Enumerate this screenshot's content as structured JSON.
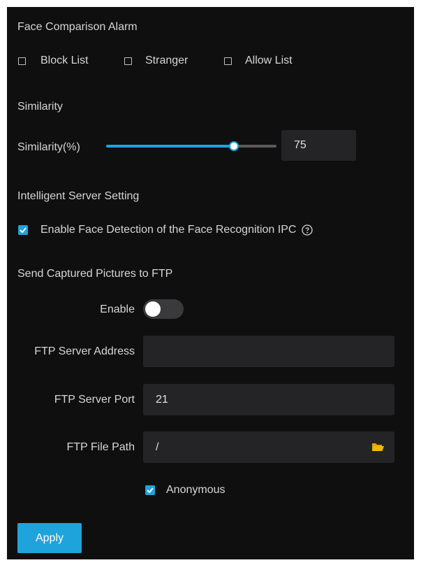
{
  "face_comparison": {
    "title": "Face Comparison Alarm",
    "options": [
      {
        "label": "Block List",
        "checked": false
      },
      {
        "label": "Stranger",
        "checked": false
      },
      {
        "label": "Allow List",
        "checked": false
      }
    ]
  },
  "similarity": {
    "title": "Similarity",
    "label": "Similarity(%)",
    "value": "75",
    "slider_fraction": 0.75,
    "accent": "#1fa3db"
  },
  "intelligent_server": {
    "title": "Intelligent Server Setting",
    "enable_face_detection_label": "Enable Face Detection of the Face Recognition IPC",
    "enable_face_detection_checked": true,
    "help_icon": "question-circle-icon"
  },
  "ftp": {
    "title": "Send Captured Pictures to FTP",
    "enable_label": "Enable",
    "enable_on": false,
    "server_address_label": "FTP Server Address",
    "server_address_value": "",
    "server_port_label": "FTP Server Port",
    "server_port_value": "21",
    "file_path_label": "FTP File Path",
    "file_path_value": "/",
    "folder_icon": "folder-icon",
    "anonymous_label": "Anonymous",
    "anonymous_checked": true
  },
  "apply_label": "Apply"
}
